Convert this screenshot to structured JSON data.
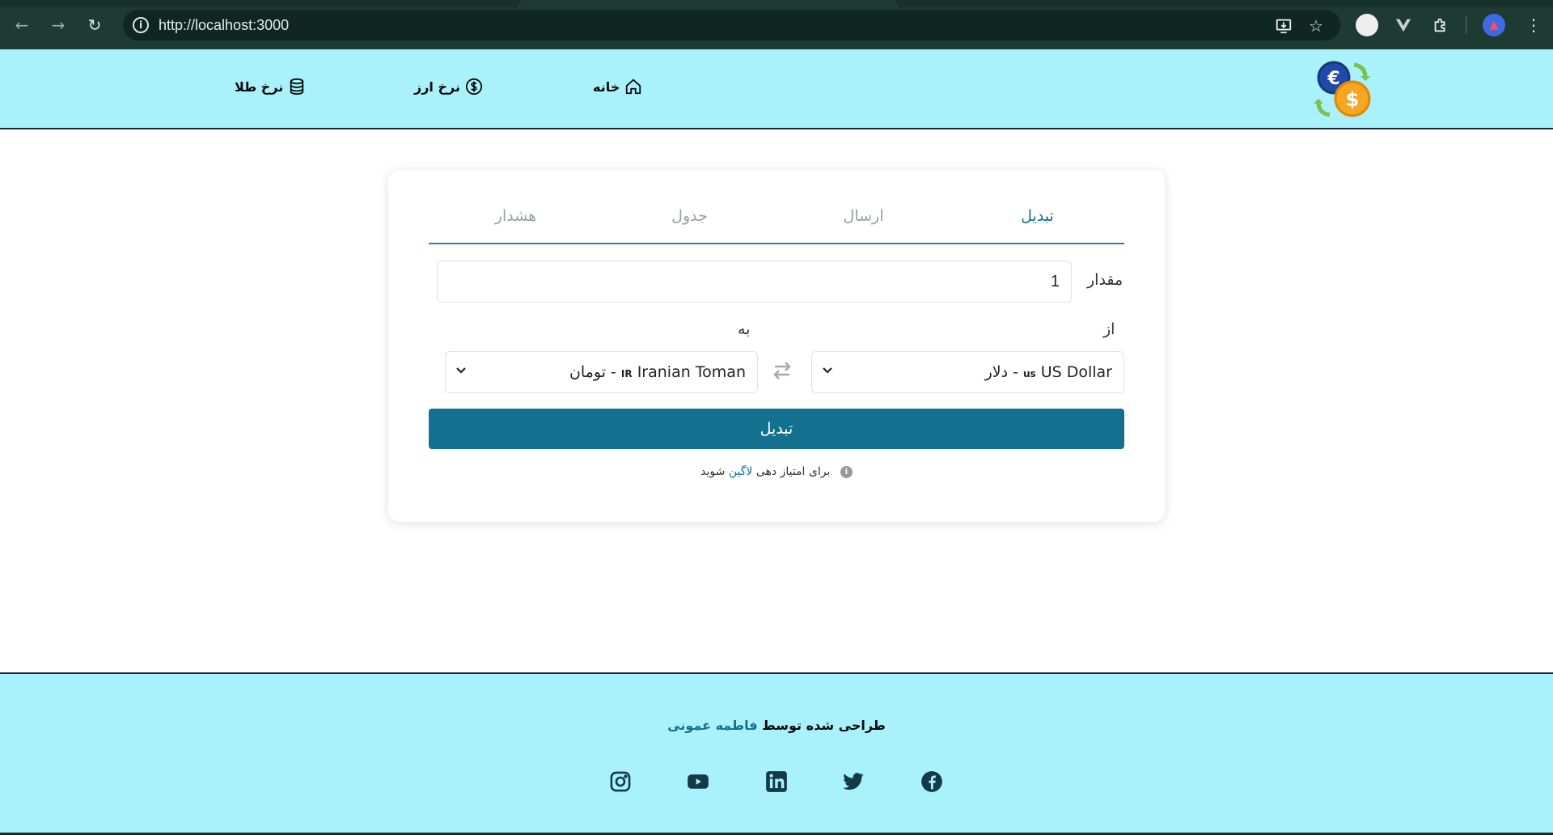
{
  "browser": {
    "url": "http://localhost:3000"
  },
  "header": {
    "nav": [
      {
        "label": "خانه",
        "icon": "home-icon"
      },
      {
        "label": "نرخ ارز",
        "icon": "dollar-icon"
      },
      {
        "label": "نرخ طلا",
        "icon": "database-icon"
      }
    ],
    "logo": "currency-exchange-logo"
  },
  "converter": {
    "tabs": [
      {
        "label": "تبدیل",
        "active": true
      },
      {
        "label": "ارسال",
        "active": false
      },
      {
        "label": "جدول",
        "active": false
      },
      {
        "label": "هشدار",
        "active": false
      }
    ],
    "amount_label": "مقدار",
    "amount_value": "1",
    "from_label": "از",
    "to_label": "به",
    "from_currency": {
      "flag": "us",
      "text": "US Dollar - دلار"
    },
    "to_currency": {
      "flag": "IR",
      "text": "Iranian Toman - تومان"
    },
    "convert_button": "تبدیل",
    "hint_prefix": "برای امتیاز دهی",
    "hint_link": "لاگین",
    "hint_suffix": "شوید"
  },
  "footer": {
    "credit_prefix": "طراحی شده توسط",
    "credit_author": "فاطمه عمونی",
    "social": [
      "facebook-icon",
      "twitter-icon",
      "linkedin-icon",
      "youtube-icon",
      "instagram-icon"
    ]
  },
  "colors": {
    "header_bg": "#a9f1fb",
    "accent": "#13718f",
    "chrome_bg": "#1d3a33"
  }
}
